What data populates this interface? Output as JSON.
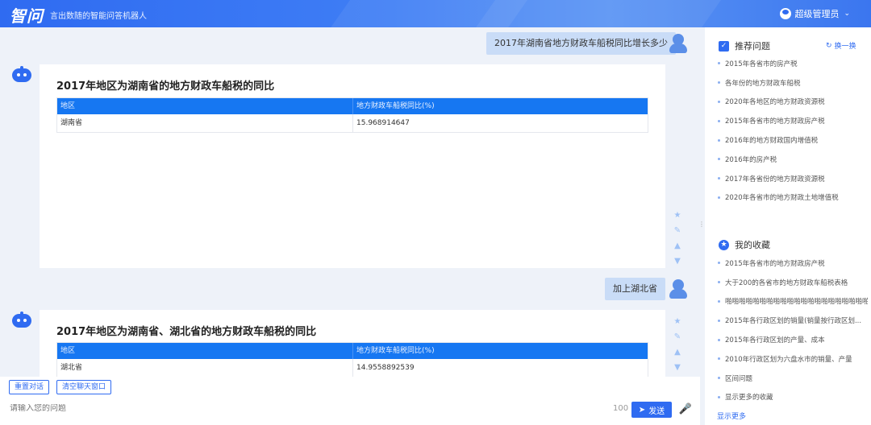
{
  "header": {
    "logo": "智问",
    "slogan": "言出数随的智能问答机器人",
    "user": "超级管理员"
  },
  "chat": {
    "messages": [
      {
        "user_question": "2017年湖南省地方财政车船税同比增长多少",
        "answer_title": "2017年地区为湖南省的地方财政车船税的同比",
        "columns": [
          "地区",
          "地方财政车船税同比(%)"
        ],
        "rows": [
          [
            "湖南省",
            "15.968914647"
          ]
        ]
      },
      {
        "user_question": "加上湖北省",
        "answer_title": "2017年地区为湖南省、湖北省的地方财政车船税的同比",
        "columns": [
          "地区",
          "地方财政车船税同比(%)"
        ],
        "rows": [
          [
            "湖北省",
            "14.9558892539"
          ]
        ]
      }
    ],
    "actions": [
      "star-icon",
      "edit-icon",
      "thumbs-up-icon",
      "thumbs-down-icon"
    ]
  },
  "toolbar": {
    "reset_label": "重置对话",
    "clear_label": "清空聊天窗口"
  },
  "input": {
    "placeholder": "请输入您的问题",
    "counter": "100",
    "send_label": "发送"
  },
  "sidebar": {
    "recommended_title": "推荐问题",
    "refresh_label": "换一换",
    "recommended": [
      "2015年各省市的房产税",
      "各年份的地方财政车船税",
      "2020年各地区的地方财政资源税",
      "2015年各省市的地方财政房产税",
      "2016年的地方财政国内增值税",
      "2016年的房产税",
      "2017年各省份的地方财政资源税",
      "2020年各省市的地方财政土地增值税"
    ],
    "favorites_title": "我的收藏",
    "favorites": [
      "2015年各省市的地方财政房产税",
      "大于200的各省市的地方财政车船税表格",
      "啪啪啪啪啪啪啪啪啪啪啪啪啪啪啪啪啪啪啪啪啪啪啪啪啪啪啪啪啪啪啪啪",
      "2015年各行政区划的销量(销量按行政区划...",
      "2015年各行政区划的产量、成本",
      "2010年行政区划为六盘水市的销量、产量",
      "区间问题",
      "显示更多的收藏"
    ],
    "more_label": "显示更多"
  },
  "colors": {
    "primary": "#2f6bf1",
    "table_header": "#1677f2",
    "user_bubble": "#c9dcf7",
    "background": "#eef2f9"
  }
}
